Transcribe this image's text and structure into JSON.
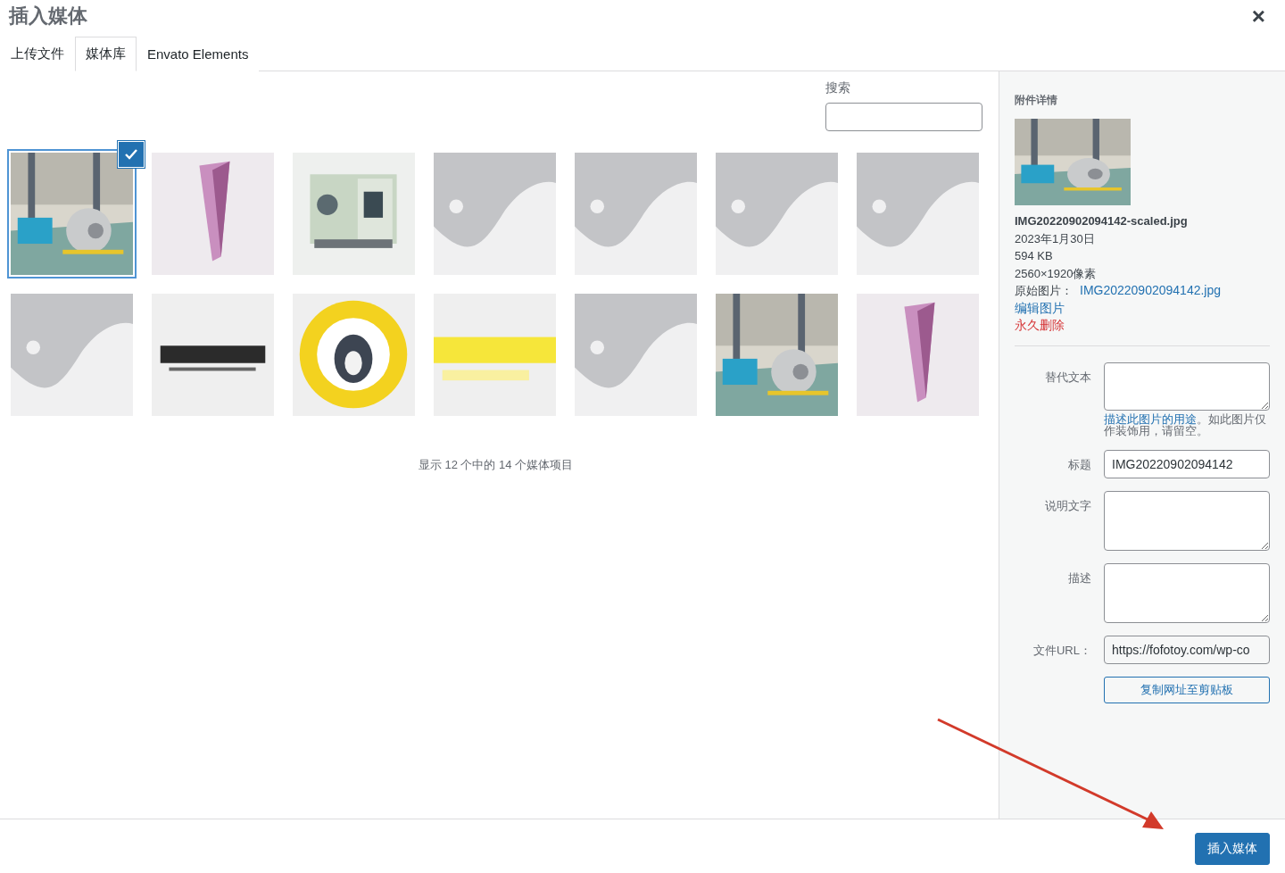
{
  "modal": {
    "title": "插入媒体",
    "close": "×"
  },
  "tabs": [
    {
      "label": "上传文件",
      "selected": false
    },
    {
      "label": "媒体库",
      "selected": true
    },
    {
      "label": "Envato Elements",
      "selected": false
    }
  ],
  "search": {
    "label": "搜索"
  },
  "media": {
    "items": [
      {
        "kind": "picture",
        "selected": true
      },
      {
        "kind": "picture",
        "selected": false
      },
      {
        "kind": "picture",
        "selected": false
      },
      {
        "kind": "placeholder",
        "selected": false
      },
      {
        "kind": "placeholder",
        "selected": false
      },
      {
        "kind": "placeholder",
        "selected": false
      },
      {
        "kind": "placeholder",
        "selected": false
      },
      {
        "kind": "placeholder",
        "selected": false
      },
      {
        "kind": "picture",
        "selected": false
      },
      {
        "kind": "picture",
        "selected": false
      },
      {
        "kind": "picture",
        "selected": false
      },
      {
        "kind": "placeholder",
        "selected": false
      },
      {
        "kind": "picture",
        "selected": false
      },
      {
        "kind": "picture",
        "selected": false
      }
    ],
    "count": "显示 12 个中的 14 个媒体项目"
  },
  "details": {
    "heading": "附件详情",
    "filename": "IMG20220902094142-scaled.jpg",
    "date": "2023年1月30日",
    "size": "594 KB",
    "dimensions": "2560×1920像素",
    "original_label": "原始图片：",
    "original_link": "IMG20220902094142.jpg",
    "edit_link": "编辑图片",
    "delete_link": "永久删除",
    "fields": [
      {
        "kind": "textarea",
        "label": "替代文本",
        "help_link": "描述此图片的用途",
        "help": "。如此图片仅作装饰用，请留空。"
      },
      {
        "kind": "input",
        "label": "标题",
        "value": "IMG20220902094142"
      },
      {
        "kind": "textarea",
        "label": "说明文字"
      },
      {
        "kind": "textarea",
        "label": "描述"
      },
      {
        "kind": "readonly",
        "label": "文件URL：",
        "value": "https://fofotoy.com/wp-co"
      }
    ],
    "copy_button": "复制网址至剪贴板"
  },
  "insert_button": "插入媒体"
}
